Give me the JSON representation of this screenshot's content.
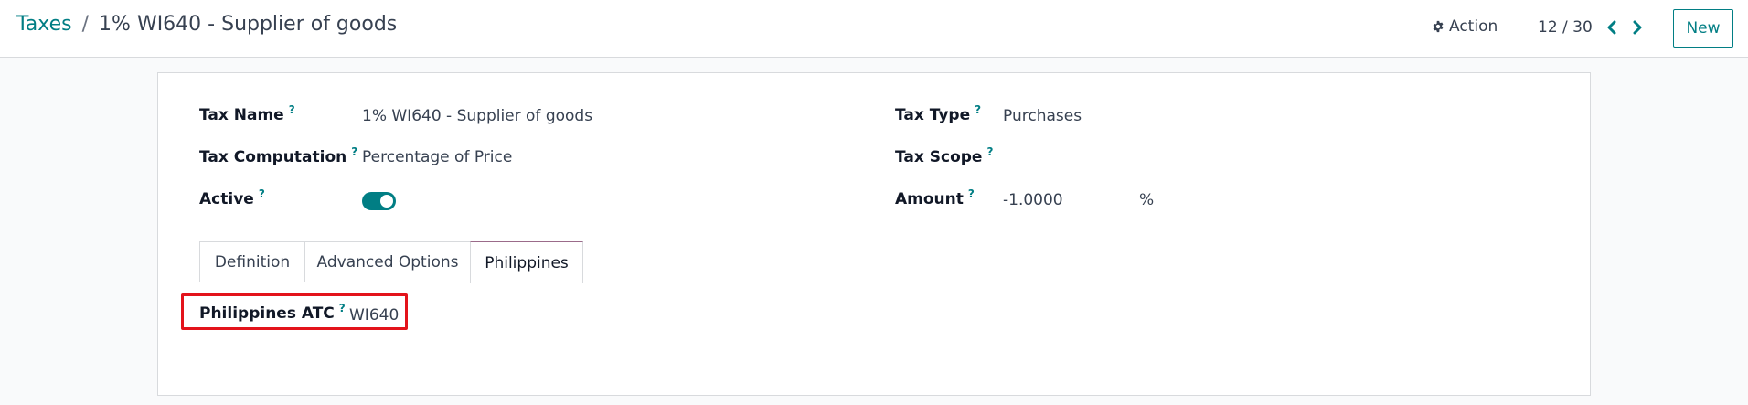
{
  "breadcrumb": {
    "parent": "Taxes",
    "separator": "/",
    "current": "1% WI640 - Supplier of goods"
  },
  "toolbar": {
    "action_label": "Action",
    "pager_value": "12 / 30",
    "new_label": "New"
  },
  "form": {
    "tax_name": {
      "label": "Tax Name",
      "help": "?",
      "value": "1% WI640 - Supplier of goods"
    },
    "tax_computation": {
      "label": "Tax Computation",
      "help": "?",
      "value": "Percentage of Price"
    },
    "active": {
      "label": "Active",
      "help": "?",
      "checked": true
    },
    "tax_type": {
      "label": "Tax Type",
      "help": "?",
      "value": "Purchases"
    },
    "tax_scope": {
      "label": "Tax Scope",
      "help": "?",
      "value": ""
    },
    "amount": {
      "label": "Amount",
      "help": "?",
      "value": "-1.0000",
      "unit": "%"
    }
  },
  "tabs": [
    {
      "label": "Definition",
      "active": false
    },
    {
      "label": "Advanced Options",
      "active": false
    },
    {
      "label": "Philippines",
      "active": true
    }
  ],
  "philippines_tab": {
    "atc": {
      "label": "Philippines ATC",
      "help": "?",
      "value": "WI640"
    }
  },
  "colors": {
    "accent": "#017e84",
    "highlight": "#e3131b",
    "active_tab_top": "#9b6b8a"
  },
  "icons": {
    "action": "gear-icon",
    "prev": "chevron-left-icon",
    "next": "chevron-right-icon"
  }
}
